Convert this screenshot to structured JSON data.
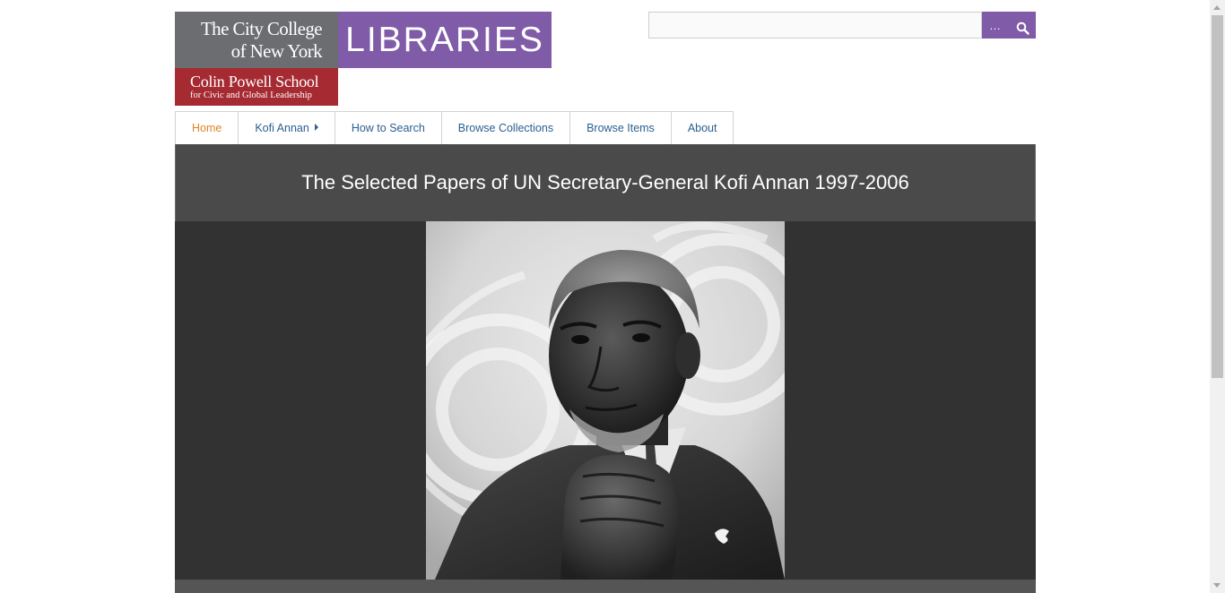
{
  "logo": {
    "ccny_line1": "The City College",
    "ccny_line2": "of New York",
    "libraries": "LIBRARIES",
    "cps_main": "Colin Powell School",
    "cps_sub": "for Civic and Global Leadership",
    "colors": {
      "gray": "#6b6d70",
      "purple": "#7f5ba8",
      "red": "#a52a32"
    }
  },
  "search": {
    "value": "",
    "placeholder": "",
    "advanced_label": "…",
    "submit_icon": "search-icon"
  },
  "nav": {
    "items": [
      {
        "label": "Home",
        "active": true
      },
      {
        "label": "Kofi Annan",
        "has_submenu": true
      },
      {
        "label": "How to Search"
      },
      {
        "label": "Browse Collections"
      },
      {
        "label": "Browse Items"
      },
      {
        "label": "About"
      }
    ],
    "colors": {
      "link": "#2a5f8f",
      "active": "#e08424"
    }
  },
  "hero": {
    "title": "The Selected Papers of UN Secretary-General Kofi Annan 1997-2006",
    "image": "portrait-photo (black and white)"
  }
}
